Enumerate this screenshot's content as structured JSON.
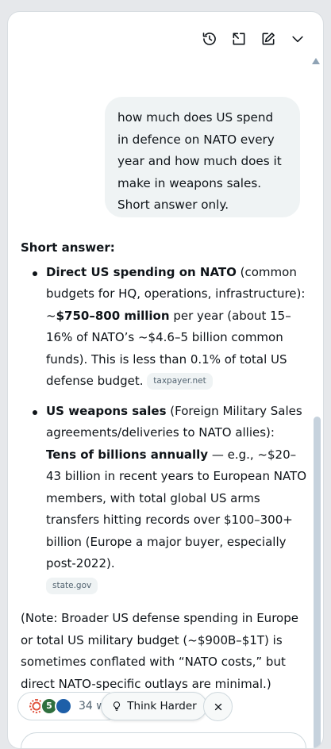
{
  "toolbar": {
    "icons": [
      "history-icon",
      "expand-icon",
      "new-chat-icon",
      "chevron-down-icon"
    ]
  },
  "user_message": "how much does US spend in defence on NATO every year and how much does it make in weapons sales. Short answer only.",
  "answer": {
    "heading": "Short answer:",
    "bullet1": {
      "bold1": "Direct US spending on NATO",
      "text1": " (common budgets for HQ, operations, infrastructure): ~",
      "bold2": "$750–800 million",
      "text2": " per year (about 15–16% of NATO’s ~$4.6–5 billion common funds). This is less than 0.1% of total US defense budget. ",
      "source": "taxpayer.net"
    },
    "bullet2": {
      "bold1": "US weapons sales",
      "text1": " (Foreign Military Sales agreements/deliveries to NATO allies): ",
      "bold2": "Tens of billions annually",
      "text2": " — e.g., ~$20–43 billion in recent years to European NATO members, with total global US arms transfers hitting records over $100–300+ billion (Europe a major buyer, especially post-2022).",
      "source": "state.gov"
    },
    "note": "(Note: Broader US defense spending in Europe or total US military budget (~$900B–$1T) is sometimes conflated with “NATO costs,” but direct NATO-specific outlays are minimal.)"
  },
  "bottom": {
    "sources_count": "34 w",
    "think_harder_label": "Think Harder",
    "favicon2_letter": "5"
  },
  "colors": {
    "bubble_bg": "#eff3f4",
    "text": "#0f1419",
    "muted": "#536471",
    "scrollbar": "#c6d2dd"
  }
}
